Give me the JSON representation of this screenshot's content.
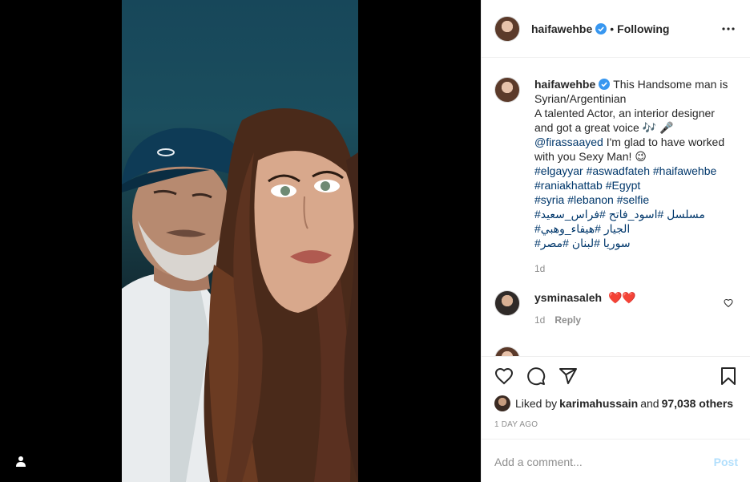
{
  "post": {
    "author": "haifawehbe",
    "follow_status": "Following",
    "separator": "•",
    "caption_lines": [
      "This Handsome man is",
      "Syrian/Argentinian",
      "A talented Actor, an interior designer",
      "and got a great voice 🎶 🎤"
    ],
    "mention": "@firassaayed",
    "mention_tail": " I'm glad to have worked",
    "caption_tail": "with you Sexy Man! 😉",
    "hashtag_lines": [
      "#elgayyar #aswadfateh #haifawehbe",
      "#raniakhattab #Egypt",
      "#syria #lebanon #selfie",
      "مسلسل #اسود_فاتح #فراس_سعيد#",
      "الجيار #هيفاء_وهبي#",
      "سوريا #لبنان #مصر#"
    ],
    "caption_age": "1d"
  },
  "comments": [
    {
      "user": "ysminasaleh",
      "text": "❤️❤️",
      "age": "1d",
      "reply_label": "Reply"
    }
  ],
  "likes": {
    "prefix": "Liked by ",
    "user": "karimahussain",
    "middle": " and ",
    "others": "97,038 others"
  },
  "timestamp": "1 DAY AGO",
  "composer": {
    "placeholder": "Add a comment...",
    "post_label": "Post"
  },
  "colors": {
    "link": "#00376b",
    "verified": "#3897f0",
    "post_disabled": "#b2dffc",
    "heart": "#ed4956"
  },
  "icons": [
    "user-tag-icon",
    "more-options-icon",
    "verified-badge-icon",
    "heart-icon",
    "comment-icon",
    "share-icon",
    "bookmark-icon"
  ]
}
